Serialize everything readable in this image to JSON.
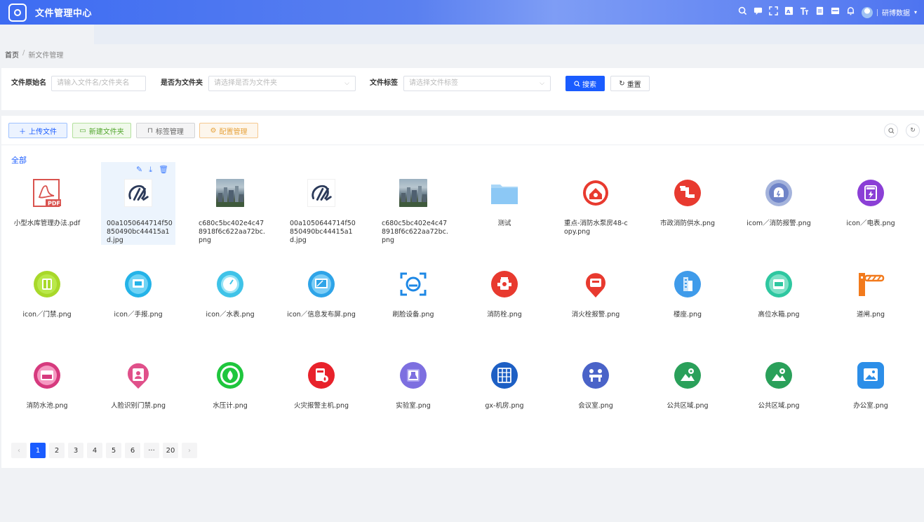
{
  "header": {
    "title": "文件管理中心",
    "user": "研博数据",
    "icons": [
      "search-icon",
      "chat-icon",
      "fullscreen-icon",
      "translate-icon",
      "font-size-icon",
      "document-icon",
      "layout-icon",
      "bell-icon"
    ]
  },
  "breadcrumb": {
    "home": "首页",
    "separator": "/",
    "current": "新文件管理"
  },
  "filters": {
    "name_label": "文件原始名",
    "name_placeholder": "请输入文件名/文件夹名",
    "is_folder_label": "是否为文件夹",
    "is_folder_placeholder": "请选择是否为文件夹",
    "tag_label": "文件标签",
    "tag_placeholder": "请选择文件标签",
    "search_label": "搜索",
    "reset_label": "重置"
  },
  "toolbar": {
    "upload_label": "上传文件",
    "new_folder_label": "新建文件夹",
    "tag_manage_label": "标签管理",
    "config_label": "配置管理"
  },
  "all_label": "全部",
  "files": [
    {
      "name": "小型水库管理办法.pdf",
      "icon": "pdf-icon",
      "color": "#d9534f"
    },
    {
      "name": "00a1050644714f50850490bc44415a1d.jpg",
      "icon": "logo-image",
      "color": "#2b3a5a"
    },
    {
      "name": "c680c5bc402e4c478918f6c622aa72bc.png",
      "icon": "city-photo",
      "color": "#6b7f8c"
    },
    {
      "name": "00a1050644714f50850490bc44415a1d.jpg",
      "icon": "logo-image",
      "color": "#2b3a5a"
    },
    {
      "name": "c680c5bc402e4c478918f6c622aa72bc.png",
      "icon": "city-photo",
      "color": "#6b7f8c"
    },
    {
      "name": "测试",
      "icon": "folder-icon",
      "color": "#8cc8f5"
    },
    {
      "name": "重点-消防水泵房48-copy.png",
      "icon": "pump-room-icon",
      "color": "#e83a2f"
    },
    {
      "name": "市政消防供水.png",
      "icon": "water-supply-icon",
      "color": "#e83a2f"
    },
    {
      "name": "icom／消防报警.png",
      "icon": "fire-alarm-icon",
      "color": "#6f84c8"
    },
    {
      "name": "icon／电表.png",
      "icon": "meter-icon",
      "color": "#8b3fd6"
    },
    {
      "name": "icon／门禁.png",
      "icon": "access-icon",
      "color": "#a8d82a"
    },
    {
      "name": "icon／手报.png",
      "icon": "manual-alarm-icon",
      "color": "#24b3e8"
    },
    {
      "name": "icon／水表.png",
      "icon": "water-meter-icon",
      "color": "#3fc3e8"
    },
    {
      "name": "icon／信息发布屏.png",
      "icon": "screen-icon",
      "color": "#2ea4e8"
    },
    {
      "name": "刷脸设备.png",
      "icon": "face-scan-icon",
      "color": "#1e88e5"
    },
    {
      "name": "消防栓.png",
      "icon": "hydrant-icon",
      "color": "#e83a2f"
    },
    {
      "name": "消火栓报警.png",
      "icon": "hydrant-alarm-icon",
      "color": "#e83a2f"
    },
    {
      "name": "楼座.png",
      "icon": "building-icon",
      "color": "#3f9bea"
    },
    {
      "name": "高位水箱.png",
      "icon": "water-tank-icon",
      "color": "#2ec7a0"
    },
    {
      "name": "道闸.png",
      "icon": "barrier-gate-icon",
      "color": "#f27a1c"
    },
    {
      "name": "消防水池.png",
      "icon": "fire-pool-icon",
      "color": "#d63a7e"
    },
    {
      "name": "人脸识别门禁.png",
      "icon": "face-access-icon",
      "color": "#e0508a"
    },
    {
      "name": "水压计.png",
      "icon": "pressure-gauge-icon",
      "color": "#1fc63d"
    },
    {
      "name": "火灾报警主机.png",
      "icon": "fire-host-icon",
      "color": "#e8222b"
    },
    {
      "name": "实验室.png",
      "icon": "lab-icon",
      "color": "#7d6fe0"
    },
    {
      "name": "gx-机房.png",
      "icon": "server-room-icon",
      "color": "#1d5fc4"
    },
    {
      "name": "会议室.png",
      "icon": "meeting-room-icon",
      "color": "#4a63c8"
    },
    {
      "name": "公共区域.png",
      "icon": "public-area-icon",
      "color": "#2aa05a"
    },
    {
      "name": "公共区域.png",
      "icon": "public-area-icon",
      "color": "#2aa05a"
    },
    {
      "name": "办公室.png",
      "icon": "office-icon",
      "color": "#2c8ee8"
    }
  ],
  "pagination": {
    "pages": [
      "1",
      "2",
      "3",
      "4",
      "5",
      "6",
      "···",
      "20"
    ],
    "current": "1",
    "prev": "‹",
    "next": "›"
  }
}
